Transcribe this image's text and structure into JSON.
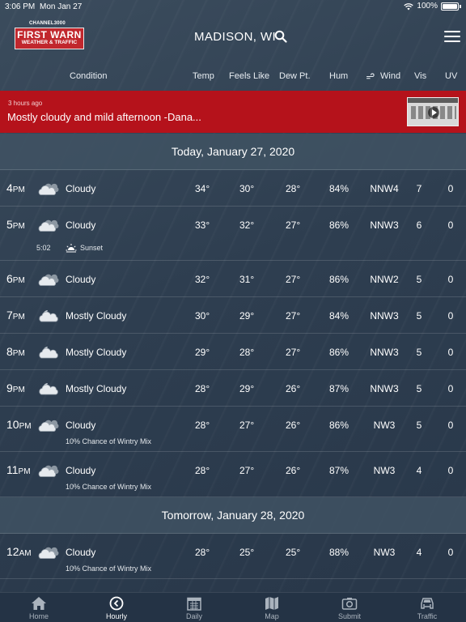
{
  "status": {
    "time": "3:06 PM",
    "date": "Mon Jan 27",
    "battery": "100%"
  },
  "header": {
    "logo_channel": "CHANNEL3000",
    "logo_title": "FIRST WARN",
    "logo_subtitle": "WEATHER & TRAFFIC",
    "city": "MADISON, WI"
  },
  "columns": {
    "condition": "Condition",
    "temp": "Temp",
    "feels": "Feels Like",
    "dew": "Dew Pt.",
    "hum": "Hum",
    "wind": "Wind",
    "vis": "Vis",
    "uv": "UV"
  },
  "alert": {
    "ago": "3 hours ago",
    "message": "Mostly cloudy and mild afternoon -Dana..."
  },
  "days": [
    {
      "label": "Today, January 27, 2020"
    },
    {
      "label": "Tomorrow, January 28, 2020"
    }
  ],
  "rows": [
    {
      "hour": "4",
      "ampm": "PM",
      "icon": "cloudy-icon",
      "cond": "Cloudy",
      "temp": "34°",
      "feels": "30°",
      "dew": "28°",
      "hum": "84%",
      "wind": "NNW4",
      "vis": "7",
      "uv": "0"
    },
    {
      "hour": "5",
      "ampm": "PM",
      "icon": "cloudy-icon",
      "cond": "Cloudy",
      "temp": "33°",
      "feels": "32°",
      "dew": "27°",
      "hum": "86%",
      "wind": "NNW3",
      "vis": "6",
      "uv": "0",
      "sunset_time": "5:02",
      "sunset_label": "Sunset"
    },
    {
      "hour": "6",
      "ampm": "PM",
      "icon": "cloudy-icon",
      "cond": "Cloudy",
      "temp": "32°",
      "feels": "31°",
      "dew": "27°",
      "hum": "86%",
      "wind": "NNW2",
      "vis": "5",
      "uv": "0"
    },
    {
      "hour": "7",
      "ampm": "PM",
      "icon": "mostly-cloudy-night-icon",
      "cond": "Mostly Cloudy",
      "temp": "30°",
      "feels": "29°",
      "dew": "27°",
      "hum": "84%",
      "wind": "NNW3",
      "vis": "5",
      "uv": "0"
    },
    {
      "hour": "8",
      "ampm": "PM",
      "icon": "mostly-cloudy-night-icon",
      "cond": "Mostly Cloudy",
      "temp": "29°",
      "feels": "28°",
      "dew": "27°",
      "hum": "86%",
      "wind": "NNW3",
      "vis": "5",
      "uv": "0"
    },
    {
      "hour": "9",
      "ampm": "PM",
      "icon": "mostly-cloudy-night-icon",
      "cond": "Mostly Cloudy",
      "temp": "28°",
      "feels": "29°",
      "dew": "26°",
      "hum": "87%",
      "wind": "NNW3",
      "vis": "5",
      "uv": "0"
    },
    {
      "hour": "10",
      "ampm": "PM",
      "icon": "cloudy-icon",
      "cond": "Cloudy",
      "temp": "28°",
      "feels": "27°",
      "dew": "26°",
      "hum": "86%",
      "wind": "NW3",
      "vis": "5",
      "uv": "0",
      "note": "10% Chance of Wintry Mix"
    },
    {
      "hour": "11",
      "ampm": "PM",
      "icon": "cloudy-icon",
      "cond": "Cloudy",
      "temp": "28°",
      "feels": "27°",
      "dew": "26°",
      "hum": "87%",
      "wind": "NW3",
      "vis": "4",
      "uv": "0",
      "note": "10% Chance of Wintry Mix"
    },
    {
      "hour": "12",
      "ampm": "AM",
      "icon": "cloudy-icon",
      "cond": "Cloudy",
      "temp": "28°",
      "feels": "25°",
      "dew": "25°",
      "hum": "88%",
      "wind": "NW3",
      "vis": "4",
      "uv": "0",
      "note": "10% Chance of Wintry Mix"
    }
  ],
  "tabs": [
    {
      "label": "Home",
      "icon": "home-icon"
    },
    {
      "label": "Hourly",
      "icon": "clock-icon",
      "active": true
    },
    {
      "label": "Daily",
      "icon": "calendar-icon"
    },
    {
      "label": "Map",
      "icon": "map-icon"
    },
    {
      "label": "Submit",
      "icon": "camera-icon"
    },
    {
      "label": "Traffic",
      "icon": "car-icon"
    }
  ]
}
